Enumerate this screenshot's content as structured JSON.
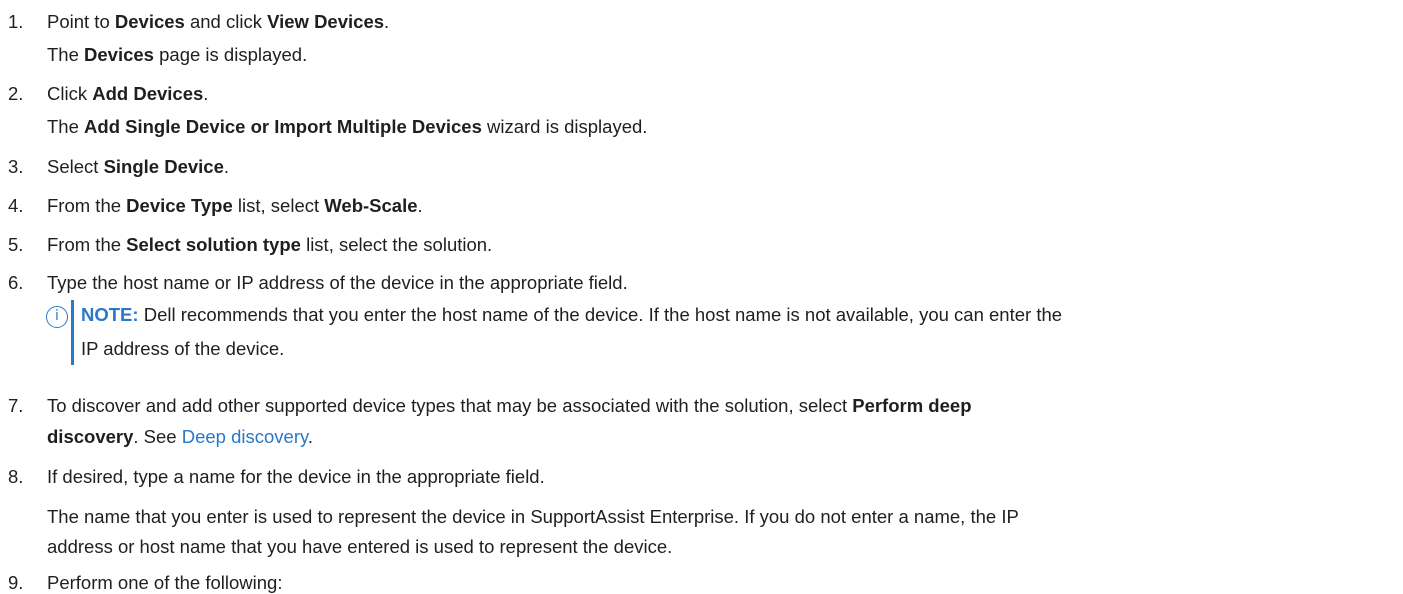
{
  "steps": [
    {
      "num": "1.",
      "l1a": "Point to ",
      "l1b": "Devices",
      "l1c": " and click ",
      "l1d": "View Devices",
      "l1e": ".",
      "l2a": "The ",
      "l2b": "Devices",
      "l2c": " page is displayed."
    },
    {
      "num": "2.",
      "l1a": "Click ",
      "l1b": "Add Devices",
      "l1c": ".",
      "l2a": "The ",
      "l2b": "Add Single Device or Import Multiple Devices",
      "l2c": " wizard is displayed."
    },
    {
      "num": "3.",
      "l1a": "Select ",
      "l1b": "Single Device",
      "l1c": "."
    },
    {
      "num": "4.",
      "l1a": "From the ",
      "l1b": "Device Type",
      "l1c": " list, select ",
      "l1d": "Web-Scale",
      "l1e": "."
    },
    {
      "num": "5.",
      "l1a": "From the ",
      "l1b": "Select solution type",
      "l1c": " list, select the solution."
    },
    {
      "num": "6.",
      "l1a": "Type the host name or IP address of the device in the appropriate field."
    },
    {
      "num": "7.",
      "l1a": "To discover and add other supported device types that may be associated with the solution, select ",
      "l1b": "Perform deep",
      "l2a": "discovery",
      "l2b": ". See ",
      "l2c": "Deep discovery",
      "l2d": "."
    },
    {
      "num": "8.",
      "l1a": "If desired, type a name for the device in the appropriate field.",
      "p1": "The name that you enter is used to represent the device in SupportAssist Enterprise. If you do not enter a name, the IP",
      "p2": "address or host name that you have entered is used to represent the device."
    },
    {
      "num": "9.",
      "l1a": "Perform one of the following:"
    }
  ],
  "note": {
    "label": "NOTE:",
    "line1": " Dell recommends that you enter the host name of the device. If the host name is not available, you can enter the",
    "line2": "IP address of the device."
  }
}
